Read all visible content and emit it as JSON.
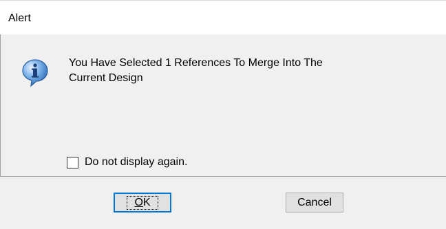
{
  "window": {
    "title": "Alert"
  },
  "message": {
    "line1": "You Have Selected 1 References To Merge Into The",
    "line2": "Current Design"
  },
  "checkbox": {
    "label": "Do not display again.",
    "checked": false
  },
  "buttons": {
    "ok_label": "OK",
    "cancel_label": "Cancel"
  },
  "icons": {
    "message_icon": "info-icon"
  },
  "colors": {
    "focus_border": "#0078d7",
    "dialog_bg": "#f0f0f0",
    "button_bg": "#e1e1e1"
  }
}
